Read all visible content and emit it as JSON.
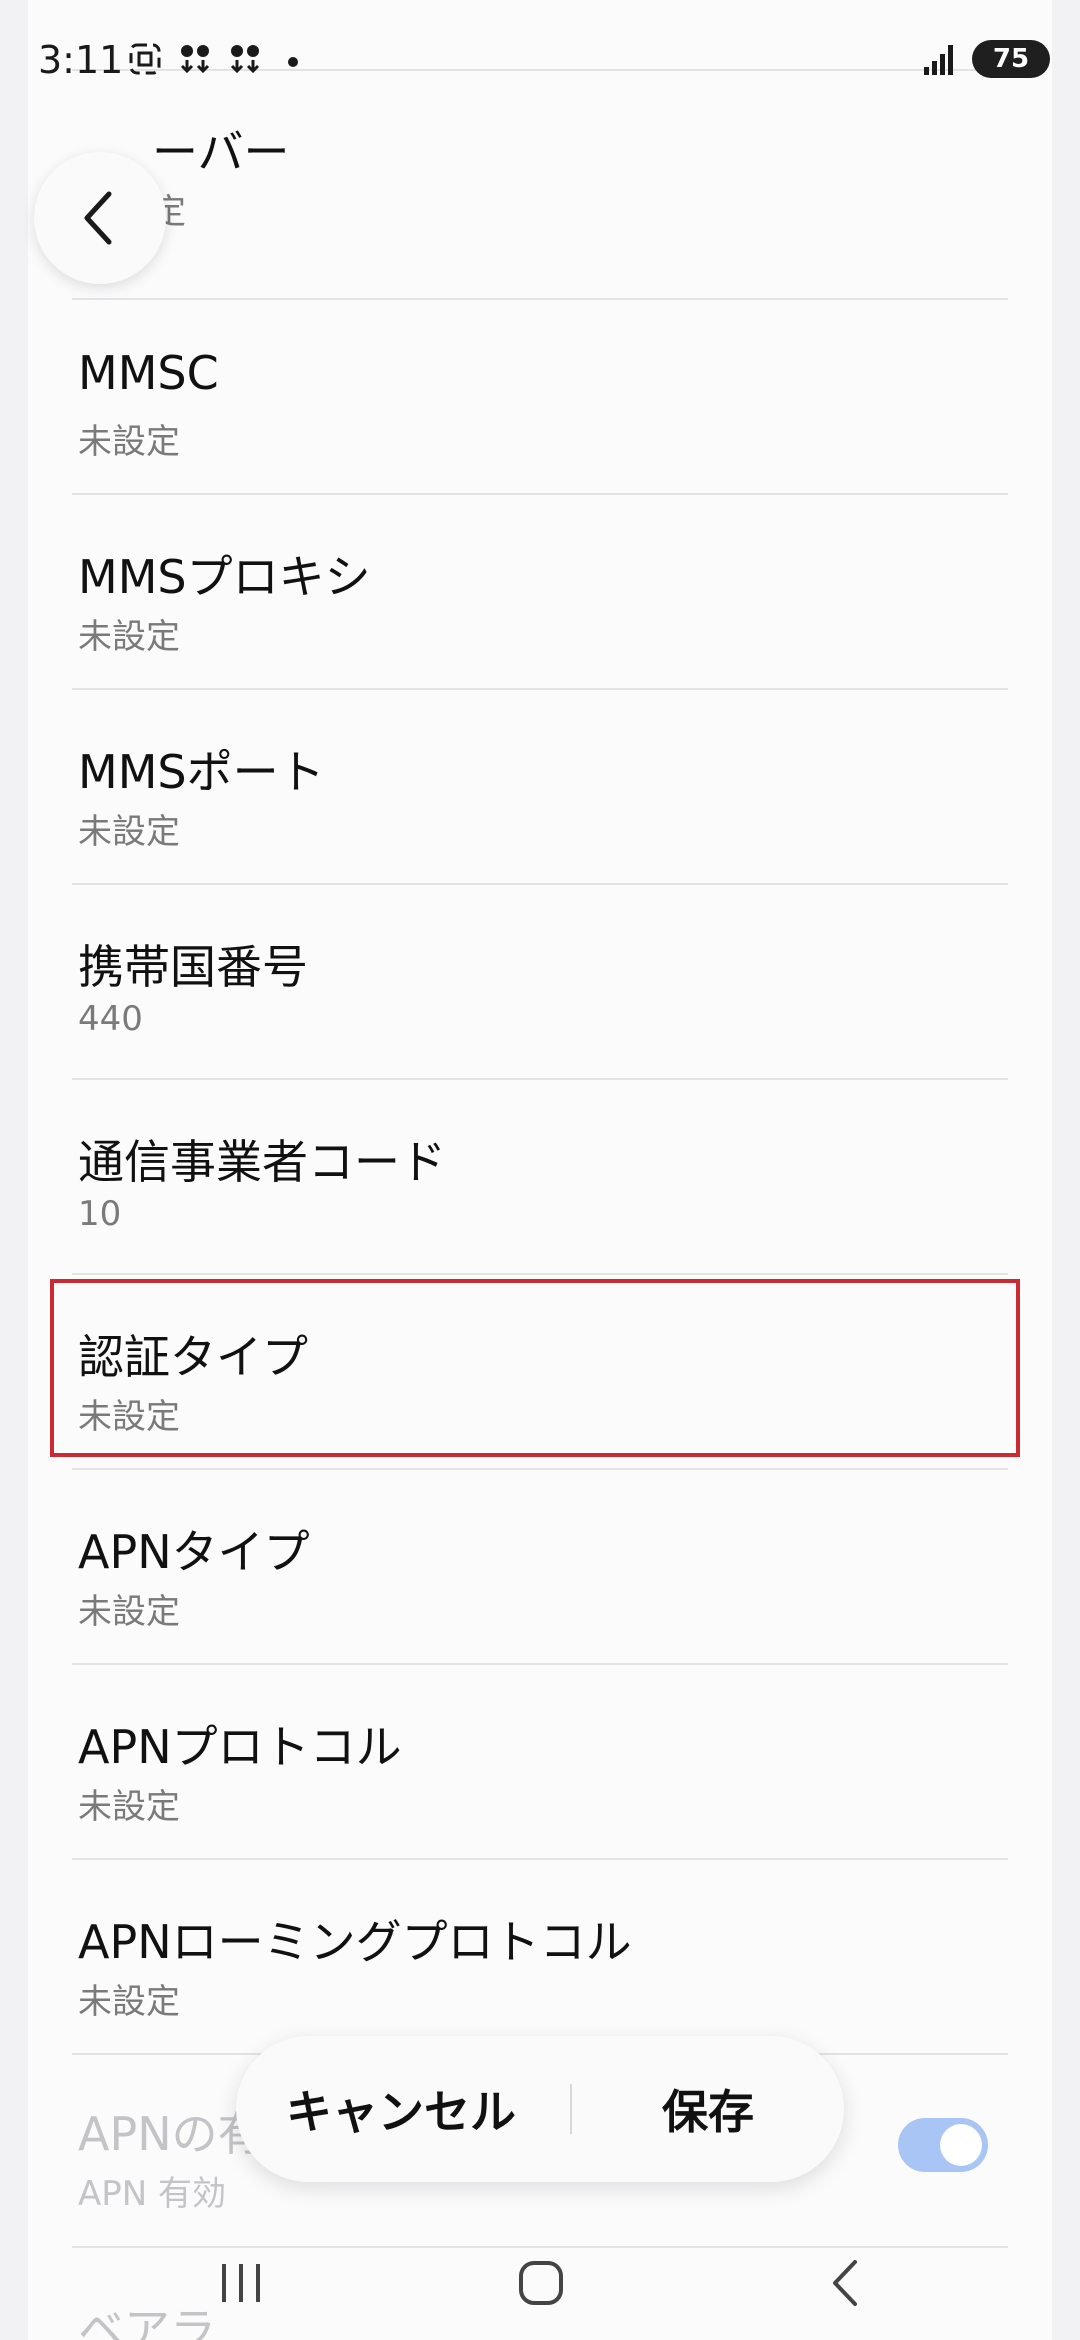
{
  "status_bar": {
    "time": "3:11",
    "icons": [
      "screenshot-icon",
      "download-icon",
      "download-icon"
    ],
    "battery": "75"
  },
  "list": {
    "top_partial": {
      "title": "ーバー",
      "sub": "定"
    },
    "items": [
      {
        "title": "MMSC",
        "sub": "未設定"
      },
      {
        "title": "MMSプロキシ",
        "sub": "未設定"
      },
      {
        "title": "MMSポート",
        "sub": "未設定"
      },
      {
        "title": "携帯国番号",
        "sub": "440"
      },
      {
        "title": "通信事業者コード",
        "sub": "10"
      },
      {
        "title": "認証タイプ",
        "sub": "未設定"
      },
      {
        "title": "APNタイプ",
        "sub": "未設定"
      },
      {
        "title": "APNプロトコル",
        "sub": "未設定"
      },
      {
        "title": "APNローミングプロトコル",
        "sub": "未設定"
      }
    ],
    "faded_item": {
      "title": "APNの有効/無効",
      "sub": "APN 有効",
      "toggle_on": true
    },
    "next_partial": {
      "title": "ベアラ"
    }
  },
  "actions": {
    "cancel_label": "キャンセル",
    "save_label": "保存"
  },
  "colors": {
    "highlight": "#cc2a33",
    "toggle": "#a9c5f5"
  }
}
